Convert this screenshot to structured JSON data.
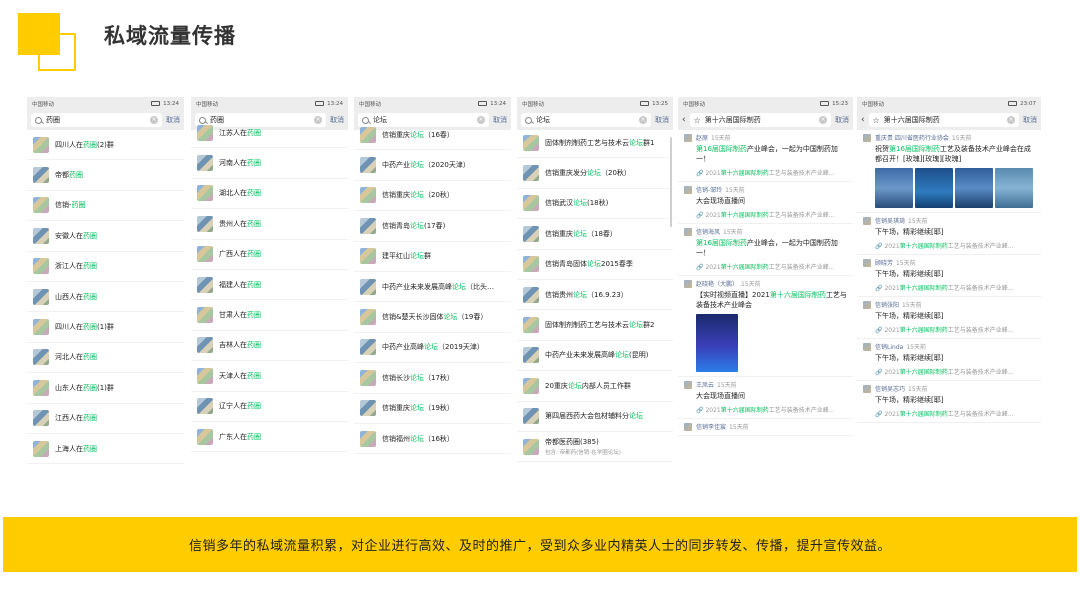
{
  "header": {
    "title": "私域流量传播"
  },
  "banner": {
    "text": "信销多年的私域流量积累，对企业进行高效、及时的推广，受到众多业内精英人士的同步转发、传播，提升宣传效益。"
  },
  "phones": [
    {
      "status": {
        "carrier": "中国移动",
        "time": "13:24"
      },
      "search": {
        "query": "药圈",
        "cancel": "取消"
      },
      "rows": [
        {
          "pre": "四川人在",
          "hl": "药圈",
          "post": "(2)群"
        },
        {
          "pre": "帝都",
          "hl": "药圈",
          "post": ""
        },
        {
          "pre": "信销-",
          "hl": "药圈",
          "post": ""
        },
        {
          "pre": "安徽人在",
          "hl": "药圈",
          "post": ""
        },
        {
          "pre": "浙江人在",
          "hl": "药圈",
          "post": ""
        },
        {
          "pre": "山西人在",
          "hl": "药圈",
          "post": ""
        },
        {
          "pre": "四川人在",
          "hl": "药圈",
          "post": "(1)群"
        },
        {
          "pre": "河北人在",
          "hl": "药圈",
          "post": ""
        },
        {
          "pre": "山东人在",
          "hl": "药圈",
          "post": "(1)群"
        },
        {
          "pre": "江西人在",
          "hl": "药圈",
          "post": ""
        },
        {
          "pre": "上海人在",
          "hl": "药圈",
          "post": ""
        }
      ]
    },
    {
      "status": {
        "carrier": "中国移动",
        "time": "13:24"
      },
      "search": {
        "query": "药圈",
        "cancel": "取消"
      },
      "rows": [
        {
          "pre": "江苏人在",
          "hl": "药圈",
          "post": ""
        },
        {
          "pre": "河南人在",
          "hl": "药圈",
          "post": ""
        },
        {
          "pre": "湖北人在",
          "hl": "药圈",
          "post": ""
        },
        {
          "pre": "贵州人在",
          "hl": "药圈",
          "post": ""
        },
        {
          "pre": "广西人在",
          "hl": "药圈",
          "post": ""
        },
        {
          "pre": "福建人在",
          "hl": "药圈",
          "post": ""
        },
        {
          "pre": "甘肃人在",
          "hl": "药圈",
          "post": ""
        },
        {
          "pre": "吉林人在",
          "hl": "药圈",
          "post": ""
        },
        {
          "pre": "天津人在",
          "hl": "药圈",
          "post": ""
        },
        {
          "pre": "辽宁人在",
          "hl": "药圈",
          "post": ""
        },
        {
          "pre": "广东人在",
          "hl": "药圈",
          "post": ""
        }
      ]
    },
    {
      "status": {
        "carrier": "中国移动",
        "time": "13:24"
      },
      "search": {
        "query": "论坛",
        "cancel": "取消"
      },
      "rows": [
        {
          "pre": "信销重庆",
          "hl": "论坛",
          "post": "（16春）"
        },
        {
          "pre": "中药产业",
          "hl": "论坛",
          "post": "（2020天津）"
        },
        {
          "pre": "信销重庆",
          "hl": "论坛",
          "post": "（20秋）"
        },
        {
          "pre": "信销青岛",
          "hl": "论坛",
          "post": "(17春)"
        },
        {
          "pre": "建平红山",
          "hl": "论坛",
          "post": "群"
        },
        {
          "pre": "中药产业未来发展高峰",
          "hl": "论坛",
          "post": "（比头…"
        },
        {
          "pre": "信销&楚天长沙固体",
          "hl": "论坛",
          "post": "（19春）"
        },
        {
          "pre": "中药产业高峰",
          "hl": "论坛",
          "post": "（2019天津）"
        },
        {
          "pre": "信销长沙",
          "hl": "论坛",
          "post": "（17秋）"
        },
        {
          "pre": "信销重庆",
          "hl": "论坛",
          "post": "（19秋）"
        },
        {
          "pre": "信销福州",
          "hl": "论坛",
          "post": "（16秋）"
        }
      ]
    },
    {
      "status": {
        "carrier": "中国移动",
        "time": "13:25"
      },
      "search": {
        "query": "论坛",
        "cancel": "取消"
      },
      "rows": [
        {
          "pre": "固体制剂制药工艺与技术云",
          "hl": "论坛",
          "post": "群1"
        },
        {
          "pre": "信销重庆发分",
          "hl": "论坛",
          "post": "（20秋）"
        },
        {
          "pre": "信销武汉",
          "hl": "论坛",
          "post": "(18秋)"
        },
        {
          "pre": "信销重庆",
          "hl": "论坛",
          "post": "（18春）"
        },
        {
          "pre": "信销青岛固体",
          "hl": "论坛",
          "post": "2015春季"
        },
        {
          "pre": "信销贵州",
          "hl": "论坛",
          "post": "（16.9.23）"
        },
        {
          "pre": "固体制剂制药工艺与技术云",
          "hl": "论坛",
          "post": "群2"
        },
        {
          "pre": "中药产业未来发展高峰",
          "hl": "论坛",
          "post": "(昆明)"
        },
        {
          "pre": "20重庆",
          "hl": "论坛",
          "post": "内部人员工作群"
        },
        {
          "pre": "第四届西药大会包材辅料分",
          "hl": "论坛",
          "post": ""
        },
        {
          "pre": "帝都医药圈(385)",
          "hl": "",
          "post": "",
          "sub": "包含: 帝都药(信销-在学圈论坛)"
        }
      ]
    },
    {
      "status": {
        "carrier": "中国移动",
        "time": "15:23"
      },
      "search": {
        "query": "第十六届国际制药",
        "cancel": "取消"
      },
      "posts": [
        {
          "name": "赵原",
          "time": "15天前",
          "text_pre": "",
          "text_hl": "第16届国际制药",
          "text_post": "产业峰会，一起为中国制药加一！",
          "link_hl": "第十六届国际制药",
          "link_post": "工艺与装备技术产业峰…"
        },
        {
          "name": "信销-邹玲",
          "time": "15天前",
          "text_pre": "大会现场直播间",
          "text_hl": "",
          "text_post": "",
          "link_hl": "第十六届国际制药",
          "link_post": "工艺与装备技术产业峰…"
        },
        {
          "name": "信销海风",
          "time": "15天前",
          "text_pre": "",
          "text_hl": "第16届国际制药",
          "text_post": "产业峰会，一起为中国制药加一！",
          "link_hl": "第十六届国际制药",
          "link_post": "工艺与装备技术产业峰…"
        },
        {
          "name": "赵晓艳（大鹏）",
          "time": "15天前",
          "text_pre": "【实时视频直播】2021",
          "text_hl": "第十六届国际制药",
          "text_post": "工艺与装备技术产业峰会",
          "image": "poster"
        },
        {
          "name": "王凤云",
          "time": "15天前",
          "text_pre": "大会现场直播间",
          "text_hl": "",
          "text_post": "",
          "link_hl": "第十六届国际制药",
          "link_post": "工艺与装备技术产业峰…"
        },
        {
          "name": "信销李佳宸",
          "time": "15天前",
          "text_pre": "",
          "text_hl": "",
          "text_post": ""
        }
      ]
    },
    {
      "status": {
        "carrier": "中国移动",
        "time": "23:07"
      },
      "search": {
        "query": "第十六届国际制药",
        "cancel": "取消"
      },
      "posts": [
        {
          "name": "重庆贵 四川省医药行业协会",
          "time": "15天前",
          "text_pre": "祝贺",
          "text_hl": "第16届国际制药",
          "text_post": "工艺及装备技术产业峰会在成都召开！[玫瑰][玫瑰][玫瑰]",
          "image": "gallery"
        },
        {
          "name": "信销吴琪琦",
          "time": "15天前",
          "text_pre": "下午场，精彩继续[耶]",
          "text_hl": "",
          "text_post": "",
          "link_hl": "第十六届国际制药",
          "link_post": "工艺与装备技术产业峰…"
        },
        {
          "name": "顾晓芳",
          "time": "15天前",
          "text_pre": "下午场，精彩继续[耶]",
          "text_hl": "",
          "text_post": "",
          "link_hl": "第十六届国际制药",
          "link_post": "工艺与装备技术产业峰…"
        },
        {
          "name": "信销张阳",
          "time": "15天前",
          "text_pre": "下午场，精彩继续[耶]",
          "text_hl": "",
          "text_post": "",
          "link_hl": "第十六届国际制药",
          "link_post": "工艺与装备技术产业峰…"
        },
        {
          "name": "信销Linda",
          "time": "15天前",
          "text_pre": "下午场，精彩继续[耶]",
          "text_hl": "",
          "text_post": "",
          "link_hl": "第十六届国际制药",
          "link_post": "工艺与装备技术产业峰…"
        },
        {
          "name": "信销吴志巧",
          "time": "15天前",
          "text_pre": "下午场，精彩继续[耶]",
          "text_hl": "",
          "text_post": "",
          "link_hl": "第十六届国际制药",
          "link_post": "工艺与装备技术产业峰…"
        }
      ]
    }
  ],
  "link_prefix": "2021",
  "colors": {
    "accent": "#ffcc00",
    "highlight": "#07c160",
    "link": "#576b95"
  },
  "icons": {
    "search": "search-icon",
    "clear": "clear-icon",
    "back": "back-icon",
    "star": "star-icon",
    "link": "link-icon"
  }
}
